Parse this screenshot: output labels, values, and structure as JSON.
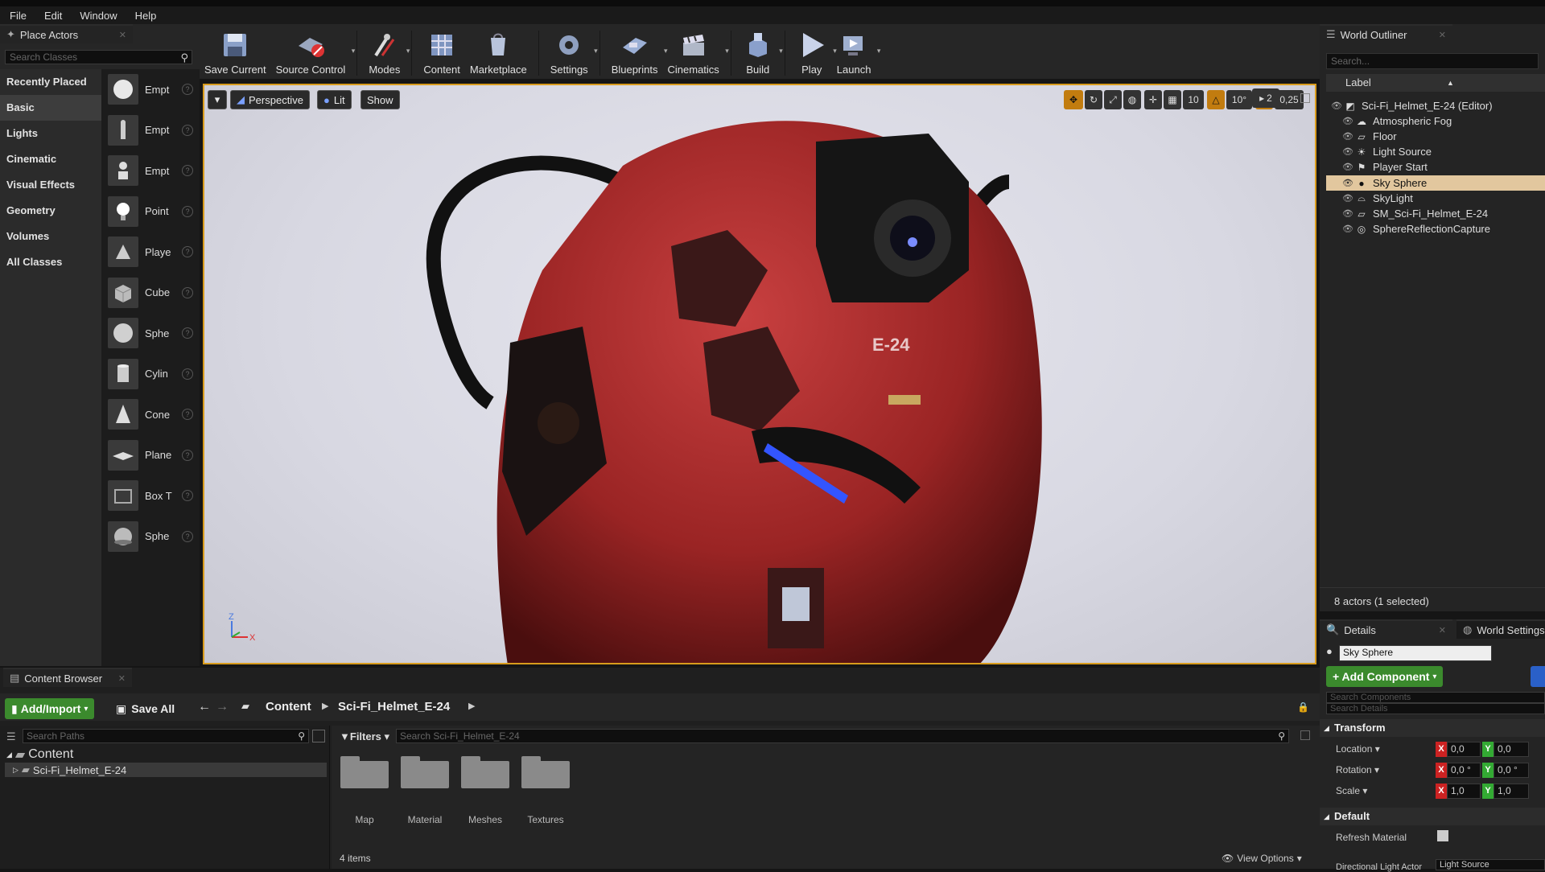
{
  "menu": [
    "File",
    "Edit",
    "Window",
    "Help"
  ],
  "place_actors": {
    "tab": "Place Actors",
    "search_placeholder": "Search Classes",
    "categories": [
      "Recently Placed",
      "Basic",
      "Lights",
      "Cinematic",
      "Visual Effects",
      "Geometry",
      "Volumes",
      "All Classes"
    ],
    "selected_category": "Basic",
    "actors": [
      "Empt",
      "Empt",
      "Empt",
      "Point",
      "Playe",
      "Cube",
      "Sphe",
      "Cylin",
      "Cone",
      "Plane",
      "Box T",
      "Sphe"
    ]
  },
  "toolbar": {
    "buttons": [
      {
        "label": "Save Current",
        "icon": "save-icon"
      },
      {
        "label": "Source Control",
        "icon": "source-control-icon"
      },
      {
        "label": "Modes",
        "icon": "modes-icon"
      },
      {
        "label": "Content",
        "icon": "content-icon"
      },
      {
        "label": "Marketplace",
        "icon": "marketplace-icon"
      },
      {
        "label": "Settings",
        "icon": "settings-icon"
      },
      {
        "label": "Blueprints",
        "icon": "blueprints-icon"
      },
      {
        "label": "Cinematics",
        "icon": "cinematics-icon"
      },
      {
        "label": "Build",
        "icon": "build-icon"
      },
      {
        "label": "Play",
        "icon": "play-icon"
      },
      {
        "label": "Launch",
        "icon": "launch-icon"
      }
    ]
  },
  "viewport": {
    "perspective": "Perspective",
    "lit": "Lit",
    "show": "Show",
    "grid_snap": "10",
    "rot_snap": "10°",
    "scale_snap": "0,25",
    "cam_speed": "2",
    "helmet_label": "E-24",
    "axis_z": "Z",
    "axis_x": "X"
  },
  "outliner": {
    "tab": "World Outliner",
    "search_placeholder": "Search...",
    "column": "Label",
    "rows": [
      {
        "label": "Sci-Fi_Helmet_E-24 (Editor)",
        "icon": "world-icon"
      },
      {
        "label": "Atmospheric Fog",
        "icon": "fog-icon"
      },
      {
        "label": "Floor",
        "icon": "mesh-icon"
      },
      {
        "label": "Light Source",
        "icon": "sun-icon"
      },
      {
        "label": "Player Start",
        "icon": "player-start-icon"
      },
      {
        "label": "Sky Sphere",
        "icon": "sphere-icon"
      },
      {
        "label": "SkyLight",
        "icon": "skylight-icon"
      },
      {
        "label": "SM_Sci-Fi_Helmet_E-24",
        "icon": "mesh-icon"
      },
      {
        "label": "SphereReflectionCapture",
        "icon": "reflection-icon"
      }
    ],
    "selected": "Sky Sphere",
    "count": "8 actors (1 selected)"
  },
  "details": {
    "tab": "Details",
    "tab2": "World Settings",
    "name": "Sky Sphere",
    "add_component": "+ Add Component",
    "search_components": "Search Components",
    "search_details": "Search Details",
    "transform": "Transform",
    "location": "Location",
    "rotation": "Rotation",
    "scale": "Scale",
    "loc_x": "0,0",
    "loc_y": "0,0",
    "rot_x": "0,0 °",
    "rot_y": "0,0 °",
    "scale_x": "1,0",
    "scale_y": "1,0",
    "default": "Default",
    "refresh_material": "Refresh Material",
    "directional_light": "Directional Light Actor",
    "directional_light_value": "Light Source"
  },
  "content_browser": {
    "tab": "Content Browser",
    "add_import": "Add/Import",
    "save_all": "Save All",
    "crumb_root": "Content",
    "crumb_folder": "Sci-Fi_Helmet_E-24",
    "search_paths": "Search Paths",
    "filters": "Filters",
    "search_placeholder": "Search Sci-Fi_Helmet_E-24",
    "tree_root": "Content",
    "tree_child": "Sci-Fi_Helmet_E-24",
    "folders": [
      "Map",
      "Material",
      "Meshes",
      "Textures"
    ],
    "item_count": "4 items",
    "view_options": "View Options"
  },
  "colors": {
    "accent": "#d89b1c",
    "selection": "#e2c79e",
    "green": "#3b8a2d",
    "helmet": "#b03030"
  }
}
